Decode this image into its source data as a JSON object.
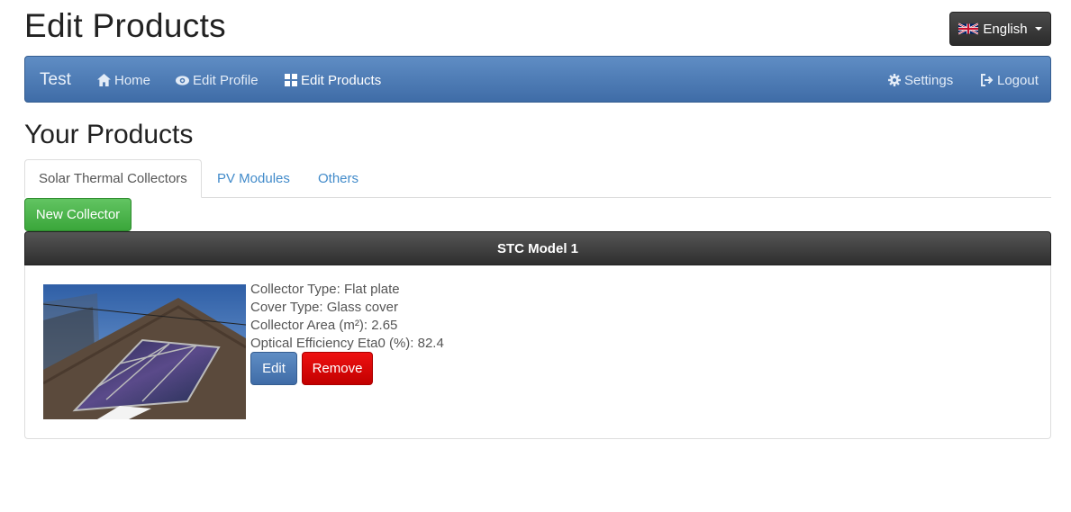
{
  "header": {
    "title": "Edit Products"
  },
  "language": {
    "label": "English"
  },
  "navbar": {
    "brand": "Test",
    "items": [
      {
        "label": "Home",
        "icon": "home-icon"
      },
      {
        "label": "Edit Profile",
        "icon": "eye-icon"
      },
      {
        "label": "Edit Products",
        "icon": "grid-icon"
      }
    ],
    "right_items": [
      {
        "label": "Settings",
        "icon": "gear-icon"
      },
      {
        "label": "Logout",
        "icon": "logout-icon"
      }
    ]
  },
  "main": {
    "section_title": "Your Products",
    "tabs": [
      {
        "label": "Solar Thermal Collectors",
        "active": true
      },
      {
        "label": "PV Modules",
        "active": false
      },
      {
        "label": "Others",
        "active": false
      }
    ],
    "new_button": "New Collector",
    "product": {
      "name": "STC Model 1",
      "fields": [
        "Collector Type: Flat plate",
        "Cover Type: Glass cover",
        "Collector Area (m²): 2.65",
        "Optical Efficiency Eta0 (%): 82.4"
      ],
      "edit_label": "Edit",
      "remove_label": "Remove"
    }
  },
  "colors": {
    "navbar": "#4a77b0",
    "success": "#4cb84c",
    "danger": "#dd0000",
    "dark": "#333333",
    "link": "#428bca"
  }
}
